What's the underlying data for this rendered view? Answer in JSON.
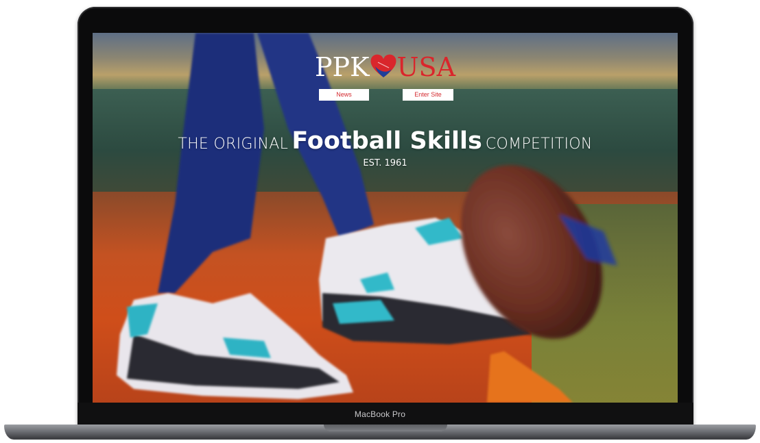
{
  "site": {
    "logo_left": "PPK",
    "logo_right": "USA",
    "nav": {
      "news_label": "News",
      "enter_label": "Enter Site"
    },
    "headline": {
      "prefix": "THE ORIGINAL",
      "highlight": "Football Skills",
      "suffix": "COMPETITION"
    },
    "established": "EST. 1961"
  },
  "device": {
    "label": "MacBook Pro"
  },
  "colors": {
    "brand_red": "#d9262c",
    "brand_blue": "#1f3f9a",
    "nav_button_bg": "#ffffff"
  },
  "icons": {
    "logo_mark": "football-heart-icon"
  }
}
